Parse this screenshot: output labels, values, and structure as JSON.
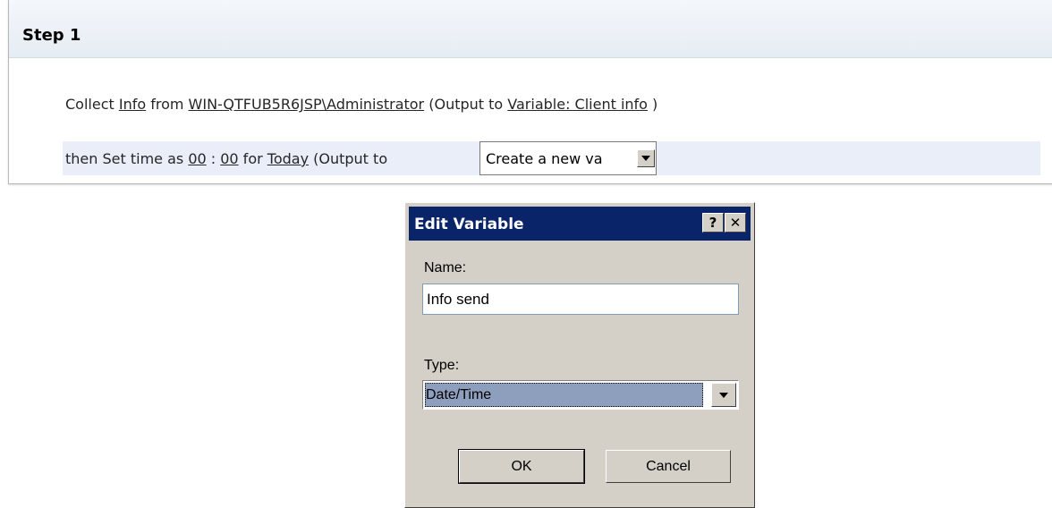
{
  "step": {
    "title": "Step 1",
    "line1": {
      "t1": "Collect ",
      "info_link": "Info",
      "t2": " from ",
      "user_link": "WIN-QTFUB5R6JSP\\Administrator",
      "t3": " (Output to ",
      "var_link": "Variable: Client info",
      "t4": " )"
    },
    "line2": {
      "t1": "then Set time as ",
      "hour_link": "00",
      "t2": " : ",
      "minute_link": "00",
      "t3": " for ",
      "day_link": "Today",
      "t4": " (Output to",
      "output_value": "Create a new va"
    }
  },
  "dialog": {
    "title": "Edit Variable",
    "help_label": "?",
    "close_label": "✕",
    "name_label": "Name:",
    "name_value": "Info send",
    "type_label": "Type:",
    "type_value": "Date/Time",
    "ok_label": "OK",
    "cancel_label": "Cancel"
  },
  "colors": {
    "titlebar": "#0a246a",
    "selection": "#8e9ebd",
    "row_highlight": "#e9eef9",
    "dialog_face": "#d4d0c8"
  },
  "icons": {
    "dropdown": "chevron-down-icon",
    "help": "help-icon",
    "close": "close-icon"
  }
}
